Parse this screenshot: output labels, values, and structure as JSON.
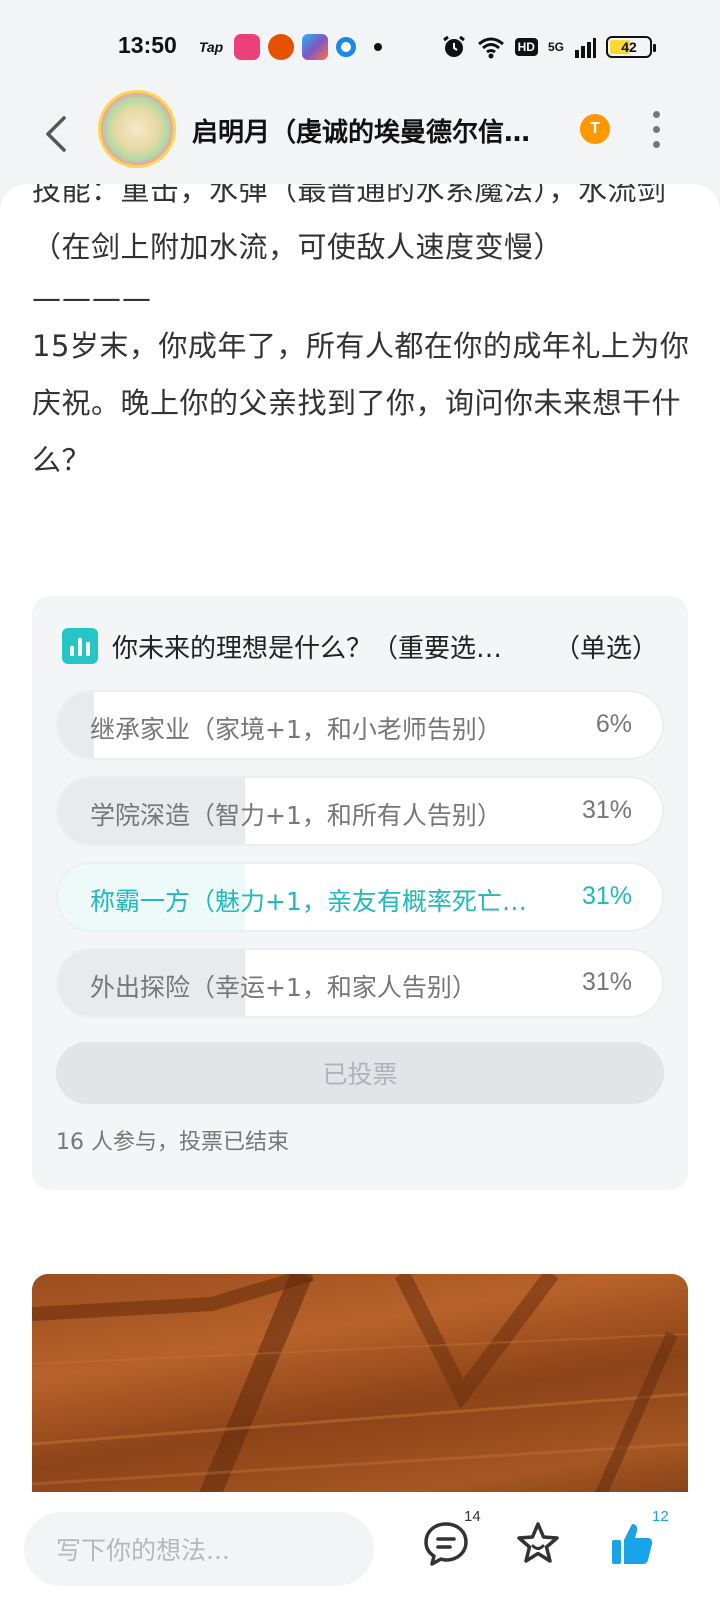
{
  "status_bar": {
    "time": "13:50",
    "tap_label": "Tap",
    "hd_label": "HD",
    "network_label": "5G",
    "battery": "42"
  },
  "header": {
    "title": "启明月（虔诚的埃曼德尔信…",
    "level_badge": "T"
  },
  "post": {
    "skills_line": "技能：重击，水弹（最普通的水系魔法），水流剑（在剑上附加水流，可使敌人速度变慢）",
    "divider": "————",
    "story": "15岁末，你成年了，所有人都在你的成年礼上为你庆祝。晚上你的父亲找到了你，询问你未来想干什么？"
  },
  "poll": {
    "title": "你未来的理想是什么？（重要选…",
    "type": "（单选）",
    "options": [
      {
        "label": "继承家业（家境+1，和小老师告别）",
        "percent": "6%",
        "fill": 0.06,
        "selected": false
      },
      {
        "label": "学院深造（智力+1，和所有人告别）",
        "percent": "31%",
        "fill": 0.31,
        "selected": false
      },
      {
        "label": "称霸一方（魅力+1，亲友有概率死亡…",
        "percent": "31%",
        "fill": 0.31,
        "selected": true
      },
      {
        "label": "外出探险（幸运+1，和家人告别）",
        "percent": "31%",
        "fill": 0.31,
        "selected": false
      }
    ],
    "voted_label": "已投票",
    "footer": "16 人参与，投票已结束"
  },
  "bottom_bar": {
    "input_placeholder": "写下你的想法...",
    "comment_count": "14",
    "like_count": "12"
  },
  "colors": {
    "accent": "#22b8bd",
    "like_blue": "#1aa3e8"
  }
}
